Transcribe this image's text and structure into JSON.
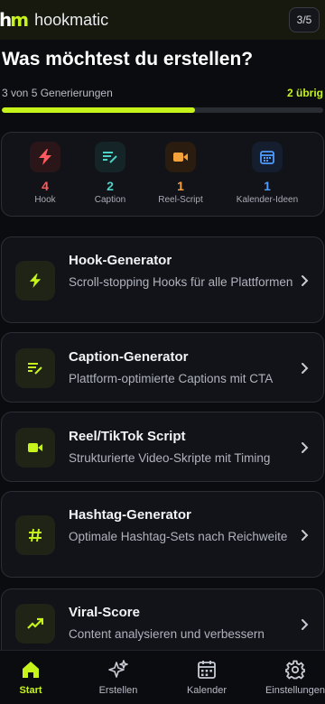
{
  "header": {
    "logo_h": "h",
    "logo_m": "m",
    "brand_name": "hookmatic",
    "counter": "3/5"
  },
  "main": {
    "title": "Was möchtest du erstellen?",
    "usage_text": "3 von 5 Generierungen",
    "usage_remaining": "2 übrig",
    "usage_progress": 0.6
  },
  "stats": [
    {
      "value": "4",
      "label": "Hook",
      "icon": "lightning-icon",
      "color": "#ff5a5f",
      "bg": "#2a1619"
    },
    {
      "value": "2",
      "label": "Caption",
      "icon": "edit-lines-icon",
      "color": "#4fd1c5",
      "bg": "#152527"
    },
    {
      "value": "1",
      "label": "Reel-Script",
      "icon": "video-camera-icon",
      "color": "#f6a23a",
      "bg": "#2a1d10"
    },
    {
      "value": "1",
      "label": "Kalender-Ideen",
      "icon": "calendar-icon",
      "color": "#4f9bff",
      "bg": "#141e2e"
    }
  ],
  "features": [
    {
      "title": "Hook-Generator",
      "desc": "Scroll-stopping Hooks für alle Plattformen",
      "icon": "lightning-icon"
    },
    {
      "title": "Caption-Generator",
      "desc": "Plattform-optimierte Captions mit CTA",
      "icon": "edit-lines-icon"
    },
    {
      "title": "Reel/TikTok Script",
      "desc": "Strukturierte Video-Skripte mit Timing",
      "icon": "video-camera-icon"
    },
    {
      "title": "Hashtag-Generator",
      "desc": "Optimale Hashtag-Sets nach Reichweite",
      "icon": "hashtag-icon"
    },
    {
      "title": "Viral-Score",
      "desc": "Content analysieren und verbessern",
      "icon": "trending-up-icon"
    }
  ],
  "nav": [
    {
      "label": "Start",
      "icon": "home-icon",
      "active": true
    },
    {
      "label": "Erstellen",
      "icon": "sparkles-icon",
      "active": false
    },
    {
      "label": "Kalender",
      "icon": "calendar-icon",
      "active": false
    },
    {
      "label": "Einstellungen",
      "icon": "gear-icon",
      "active": false
    }
  ],
  "colors": {
    "accent": "#c6f31a",
    "background": "#0b0c10",
    "card": "#121318"
  }
}
